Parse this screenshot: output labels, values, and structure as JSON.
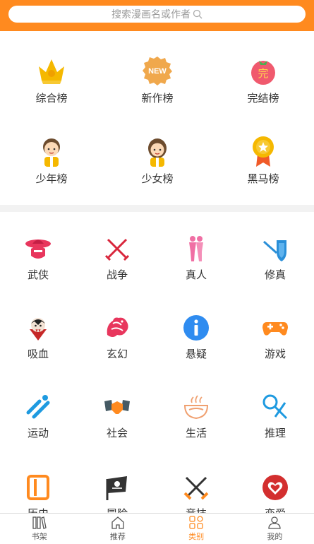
{
  "search": {
    "placeholder": "搜索漫画名或作者"
  },
  "rankings": [
    {
      "label": "综合榜",
      "icon": "crown-icon"
    },
    {
      "label": "新作榜",
      "icon": "new-badge-icon"
    },
    {
      "label": "完结榜",
      "icon": "tomato-complete-icon"
    },
    {
      "label": "少年榜",
      "icon": "boy-icon"
    },
    {
      "label": "少女榜",
      "icon": "girl-icon"
    },
    {
      "label": "黑马榜",
      "icon": "medal-icon"
    }
  ],
  "categories": [
    {
      "label": "武侠",
      "icon": "hat-icon",
      "color": "#e8365d"
    },
    {
      "label": "战争",
      "icon": "crossed-swords-icon",
      "color": "#d9263c"
    },
    {
      "label": "真人",
      "icon": "couple-icon",
      "color": "#f06fa4"
    },
    {
      "label": "修真",
      "icon": "sword-shield-icon",
      "color": "#2a8fd8"
    },
    {
      "label": "吸血",
      "icon": "vampire-icon",
      "color": "#c62828"
    },
    {
      "label": "玄幻",
      "icon": "dragon-icon",
      "color": "#e8365d"
    },
    {
      "label": "悬疑",
      "icon": "info-icon",
      "color": "#2f8cf0"
    },
    {
      "label": "游戏",
      "icon": "gamepad-icon",
      "color": "#ff8a1f"
    },
    {
      "label": "运动",
      "icon": "sports-icon",
      "color": "#1e9ae0"
    },
    {
      "label": "社会",
      "icon": "handshake-icon",
      "color": "#ff8a1f"
    },
    {
      "label": "生活",
      "icon": "coffee-icon",
      "color": "#f0a070"
    },
    {
      "label": "推理",
      "icon": "magnifier-scissors-icon",
      "color": "#1e9ae0"
    },
    {
      "label": "历史",
      "icon": "scroll-icon",
      "color": "#ff8a1f"
    },
    {
      "label": "冒险",
      "icon": "pirate-flag-icon",
      "color": "#333333"
    },
    {
      "label": "竞技",
      "icon": "battle-swords-icon",
      "color": "#333333"
    },
    {
      "label": "恋爱",
      "icon": "heart-icon",
      "color": "#d32f2f"
    }
  ],
  "tabs": [
    {
      "label": "书架",
      "icon": "bookshelf-icon",
      "active": false
    },
    {
      "label": "推荐",
      "icon": "home-icon",
      "active": false
    },
    {
      "label": "类别",
      "icon": "category-icon",
      "active": true
    },
    {
      "label": "我的",
      "icon": "user-icon",
      "active": false
    }
  ],
  "colors": {
    "accent": "#ff8a1f",
    "divider": "#f2f2f2",
    "text": "#333333"
  }
}
